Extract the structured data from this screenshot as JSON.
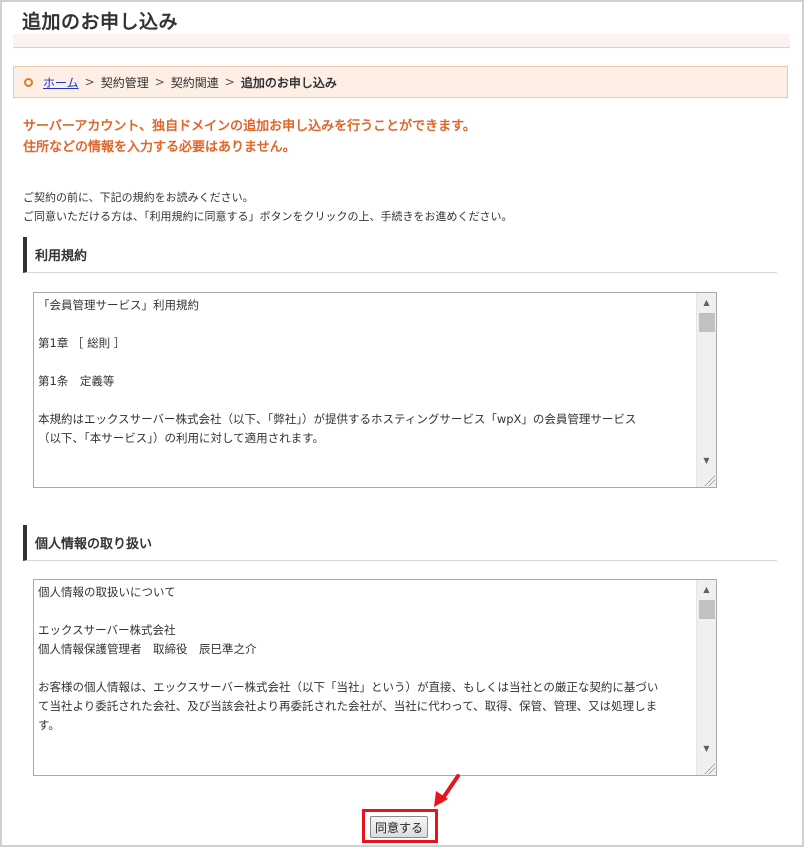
{
  "page": {
    "title": "追加のお申し込み"
  },
  "breadcrumb": {
    "home": "ホーム",
    "separator": ">",
    "items": [
      "契約管理",
      "契約関連"
    ],
    "current": "追加のお申し込み"
  },
  "notice": {
    "line1": "サーバーアカウント、独自ドメインの追加お申し込みを行うことができます。",
    "line2": "住所などの情報を入力する必要はありません。"
  },
  "intro": {
    "line1": "ご契約の前に、下記の規約をお読みください。",
    "line2": "ご同意いただける方は、「利用規約に同意する」ボタンをクリックの上、手続きをお進めください。"
  },
  "terms": {
    "heading": "利用規約",
    "lines": [
      "「会員管理サービス」利用規約",
      "",
      "第1章 ［ 総則 ］",
      "",
      "第1条　定義等",
      "",
      "本規約はエックスサーバー株式会社（以下、「弊社」）が提供するホスティングサービス「wpX」の会員管理サービス",
      "（以下、「本サービス」）の利用に対して適用されます。"
    ]
  },
  "privacy": {
    "heading": "個人情報の取り扱い",
    "lines": [
      "個人情報の取扱いについて",
      "",
      "エックスサーバー株式会社",
      "個人情報保護管理者　取締役　辰巳準之介",
      "",
      "お客様の個人情報は、エックスサーバー株式会社（以下「当社」という）が直接、もしくは当社との厳正な契約に基づい",
      "て当社より委託された会社、及び当該会社より再委託された会社が、当社に代わって、取得、保管、管理、又は処理しま",
      "す。"
    ]
  },
  "actions": {
    "agree_label": "同意する"
  },
  "colors": {
    "accent": "#e0662a",
    "link": "#1a38c8",
    "highlight": "#e8141c",
    "breadcrumb_bg": "#fdeee6"
  },
  "icons": {
    "scroll_up": "triangle-up-icon",
    "scroll_down": "triangle-down-icon",
    "resize": "resize-grip-icon",
    "pointer": "red-arrow-icon"
  }
}
